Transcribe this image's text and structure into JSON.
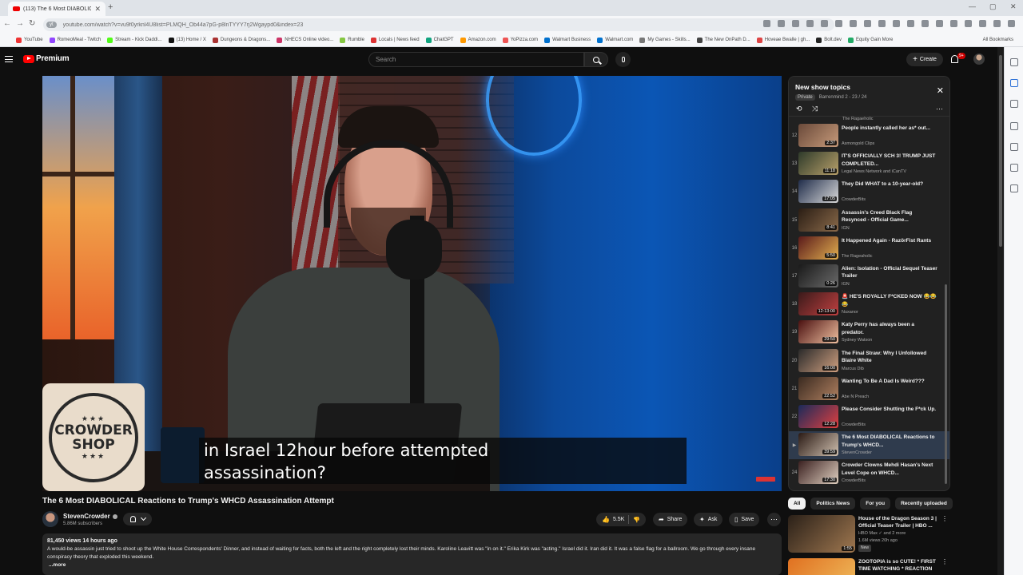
{
  "browser": {
    "tab_title": "(113) The 6 Most DIABOLIC...",
    "url": "youtube.com/watch?v=vu9f0yrknl4U8list=PLMQH_Ob44a7pG-p8lnTYYY7rj2Wgaypd0&index=23",
    "bookmarks": [
      "YouTube",
      "RomeoMeal - Twitch",
      "Stream - Kick Daddi...",
      "(13) Home / X",
      "Dungeons & Dragons...",
      "NHECS Online video...",
      "Rumble",
      "Locals | News feed",
      "ChatGPT",
      "Amazon.com",
      "YoPizza.com",
      "Walmart Business",
      "Walmart.com",
      "My Games - Skills...",
      "The New OnPath D...",
      "Hoveae Bwalle | gh...",
      "Bolt.dev",
      "Equity Gain More"
    ],
    "all_bookmarks": "All Bookmarks",
    "colors": {
      "bar": "#f6f7f9",
      "tabbar": "#dfe3e8"
    }
  },
  "header": {
    "logo": "Premium",
    "search_placeholder": "Search",
    "create_label": "Create",
    "notif_count": "9+"
  },
  "player": {
    "caption_line1": "in Israel 12hour before attempted",
    "caption_line2": "assassination?",
    "overlay_brand": [
      "CROWDER",
      "SHOP"
    ]
  },
  "video": {
    "title": "The 6 Most DIABOLICAL Reactions to Trump's WHCD Assassination Attempt",
    "channel": "StevenCrowder",
    "subscribers": "5.86M subscribers",
    "likes": "5.5K",
    "share_label": "Share",
    "ask_label": "Ask",
    "save_label": "Save",
    "views_time": "81,450 views  14 hours ago",
    "description": "A would-be assassin just tried to shoot up the White House Correspondents' Dinner, and instead of waiting for facts, both the left and the right completely lost their minds. Karoline Leavitt was \"in on it.\" Erika Kirk was \"acting.\" Israel did it. Iran did it. It was a false flag for a ballroom. We go through every insane conspiracy theory that exploded this weekend.",
    "more_label": "...more"
  },
  "playlist": {
    "title": "New show topics",
    "private_label": "Private",
    "owner_progress": "Barrenmind 2 - 23 / 24",
    "partial_channel": "The Ragaeholic",
    "items": [
      {
        "idx": "12",
        "title": "People instantly called her as* out...",
        "channel": "Asmongold Clips",
        "dur": "2:37",
        "c1": "#6a4a3a",
        "c2": "#c79a7a"
      },
      {
        "idx": "13",
        "title": "IT'S OFFICIALLY SCH 3! TRUMP JUST COMPLETED...",
        "channel": "Legal News Network and iCanTV",
        "dur": "11:18",
        "c1": "#2e3a2a",
        "c2": "#b8a06a"
      },
      {
        "idx": "14",
        "title": "They Did WHAT to a 10-year-old?",
        "channel": "CrowderBits",
        "dur": "17:05",
        "c1": "#1f2c4a",
        "c2": "#d9d9d9"
      },
      {
        "idx": "15",
        "title": "Assassin's Creed Black Flag Resynced - Official Game...",
        "channel": "IGN",
        "dur": "8:41",
        "c1": "#2a1d14",
        "c2": "#8a6a4a"
      },
      {
        "idx": "16",
        "title": "It Happened Again - RazörFist Rants",
        "channel": "The Rageaholic",
        "dur": "5:50",
        "c1": "#5a1a1a",
        "c2": "#e2b050"
      },
      {
        "idx": "17",
        "title": "Alien: Isolation - Official Sequel Teaser Trailer",
        "channel": "IGN",
        "dur": "0:26",
        "c1": "#1a1a1a",
        "c2": "#6a6a6a"
      },
      {
        "idx": "18",
        "title": "🚨 HE'S ROYALLY F*CKED NOW 😂😂😂",
        "channel": "Nuxanor",
        "dur": "12:13:00",
        "c1": "#3a1a1a",
        "c2": "#c04040"
      },
      {
        "idx": "19",
        "title": "Katy Perry has always been a predator.",
        "channel": "Sydney Watson",
        "dur": "29:50",
        "c1": "#4a1010",
        "c2": "#f0c0a0"
      },
      {
        "idx": "20",
        "title": "The Final Straw: Why I Unfollowed Blaire White",
        "channel": "Marcus Dib",
        "dur": "16:00",
        "c1": "#2a2a2a",
        "c2": "#d0a080"
      },
      {
        "idx": "21",
        "title": "Wanting To Be A Dad Is Weird???",
        "channel": "Abe N Preach",
        "dur": "22:52",
        "c1": "#3a2a20",
        "c2": "#b08060"
      },
      {
        "idx": "22",
        "title": "Please Consider Shutting the F*ck Up.",
        "channel": "CrowderBits",
        "dur": "12:28",
        "c1": "#1a2a5a",
        "c2": "#e04040"
      },
      {
        "idx": "▶",
        "title": "The 6 Most DIABOLICAL Reactions to Trump's WHCD...",
        "channel": "StevenCrowder",
        "dur": "39:59",
        "c1": "#2a1a14",
        "c2": "#d0c0b0"
      },
      {
        "idx": "24",
        "title": "Crowder Clowns Mehdi Hasan's Next Level Cope on WHCD...",
        "channel": "CrowderBits",
        "dur": "17:30",
        "c1": "#3a2020",
        "c2": "#e0d0c0"
      }
    ]
  },
  "recommendations": {
    "chips": [
      "All",
      "Politics News",
      "For you",
      "Recently uploaded"
    ],
    "items": [
      {
        "title": "House of the Dragon Season 3 | Official Teaser Trailer | HBO ...",
        "channel": "HBO Max",
        "extra": "and 2 more",
        "meta": "1.6M views  20h ago",
        "badge": "New",
        "dur": "1:55",
        "c1": "#2a2018",
        "c2": "#a07850"
      },
      {
        "title": "ZOOTOPIA is so CUTE! * FIRST TIME WATCHING * REACTION ...",
        "channel": "",
        "extra": "",
        "meta": "",
        "badge": "",
        "dur": "",
        "c1": "#e07020",
        "c2": "#f0c060"
      }
    ]
  }
}
